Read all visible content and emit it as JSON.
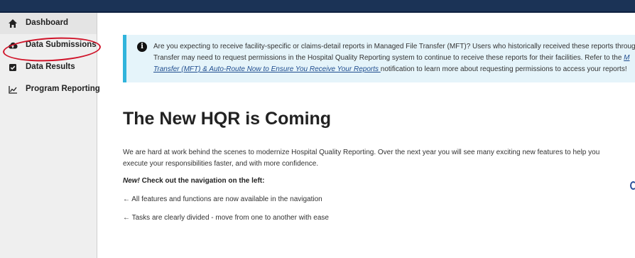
{
  "sidebar": {
    "items": [
      {
        "label": "Dashboard",
        "icon": "home-icon"
      },
      {
        "label": "Data Submissions",
        "icon": "cloud-upload-icon"
      },
      {
        "label": "Data Results",
        "icon": "checkbox-icon"
      },
      {
        "label": "Program Reporting",
        "icon": "line-chart-icon"
      }
    ]
  },
  "alert": {
    "icon": "info-icon",
    "line1": "Are you expecting to receive facility-specific or claims-detail reports in Managed File Transfer (MFT)? Users who historically received these reports throug",
    "line2_pre": "Transfer may need to request permissions in the Hospital Quality Reporting system to continue to receive these reports for their facilities. Refer to the ",
    "line2_link": "M",
    "line3_link": "Transfer (MFT) & Auto-Route Now to Ensure You Receive Your Reports ",
    "line3_post": "notification to learn more about requesting permissions to access your reports!"
  },
  "main": {
    "heading": "The New HQR is Coming",
    "intro_line1": "We are hard at work behind the scenes to modernize Hospital Quality Reporting. Over the next year you will see many exciting new features to help you",
    "intro_line2": "execute your responsibilities faster, and with more confidence.",
    "new_label": "New!",
    "new_text": " Check out the navigation on the left:",
    "features": [
      "← All features and functions are now available in the navigation",
      "← Tasks are clearly divided - move from one to another with ease"
    ]
  },
  "colors": {
    "topbar": "#1b3356",
    "alert_border": "#31b4dc",
    "alert_bg": "#e5f4fa",
    "annotation": "#d0142a"
  }
}
